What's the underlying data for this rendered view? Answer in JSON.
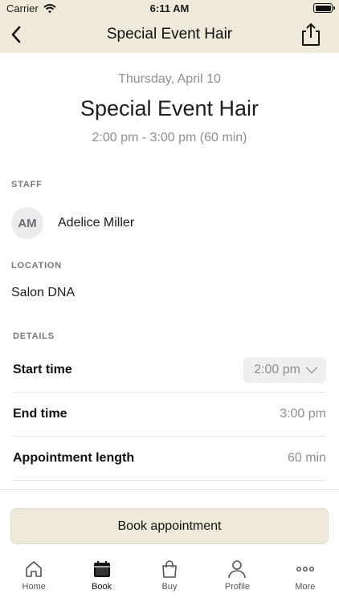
{
  "status_bar": {
    "carrier": "Carrier",
    "time": "6:11 AM"
  },
  "navbar": {
    "title": "Special Event Hair",
    "back_icon": "chevron-left-icon",
    "share_icon": "share-icon"
  },
  "appointment": {
    "date": "Thursday, April 10",
    "service": "Special Event Hair",
    "time_range": "2:00 pm - 3:00 pm (60 min)"
  },
  "staff": {
    "label": "STAFF",
    "initials": "AM",
    "name": "Adelice Miller"
  },
  "location": {
    "label": "LOCATION",
    "name": "Salon DNA"
  },
  "details": {
    "label": "DETAILS",
    "start_time": {
      "label": "Start time",
      "value": "2:00 pm"
    },
    "end_time": {
      "label": "End time",
      "value": "3:00 pm"
    },
    "length": {
      "label": "Appointment length",
      "value": "60 min"
    }
  },
  "book_button": {
    "label": "Book appointment"
  },
  "tabs": [
    {
      "label": "Home",
      "icon": "home-icon"
    },
    {
      "label": "Book",
      "icon": "calendar-icon",
      "active": true
    },
    {
      "label": "Buy",
      "icon": "shopping-bag-icon"
    },
    {
      "label": "Profile",
      "icon": "person-icon"
    },
    {
      "label": "More",
      "icon": "more-icon"
    }
  ],
  "colors": {
    "header_bg": "#efe9da",
    "muted_text": "#8e8e93",
    "button_bg": "#efe9da"
  }
}
